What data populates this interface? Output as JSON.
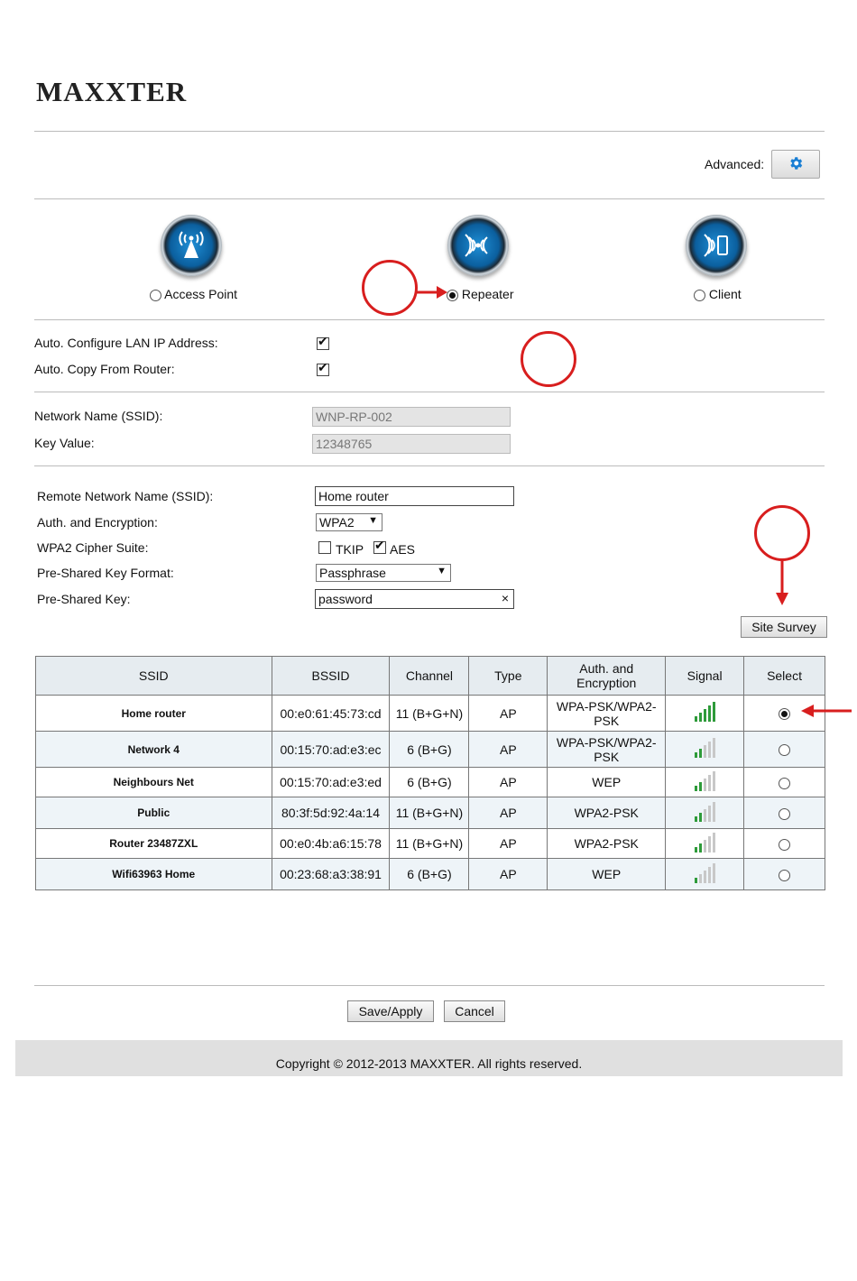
{
  "brand": {
    "logo": "MAXXTER"
  },
  "advanced": {
    "label": "Advanced:",
    "icon": "gear-icon"
  },
  "modes": [
    {
      "label": "Access Point",
      "icon": "access-point-icon",
      "selected": false
    },
    {
      "label": "Repeater",
      "icon": "repeater-icon",
      "selected": true
    },
    {
      "label": "Client",
      "icon": "client-icon",
      "selected": false
    }
  ],
  "auto": {
    "lan_ip_label": "Auto. Configure LAN IP Address:",
    "lan_ip_checked": true,
    "copy_label": "Auto. Copy From Router:",
    "copy_checked": true
  },
  "local": {
    "ssid_label": "Network Name (SSID):",
    "ssid_value": "WNP-RP-002",
    "key_label": "Key Value:",
    "key_value": "12348765"
  },
  "remote": {
    "ssid_label": "Remote Network Name (SSID):",
    "ssid_value": "Home router",
    "auth_label": "Auth. and Encryption:",
    "auth_value": "WPA2",
    "cipher_label": "WPA2 Cipher Suite:",
    "tkip_label": "TKIP",
    "tkip_checked": false,
    "aes_label": "AES",
    "aes_checked": true,
    "psk_format_label": "Pre-Shared Key Format:",
    "psk_format_value": "Passphrase",
    "psk_label": "Pre-Shared Key:",
    "psk_value": "password",
    "clear_glyph": "×"
  },
  "site_survey": {
    "label": "Site Survey"
  },
  "table": {
    "headers": [
      "SSID",
      "BSSID",
      "Channel",
      "Type",
      "Auth. and Encryption",
      "Signal",
      "Select"
    ],
    "rows": [
      {
        "ssid": "Home router",
        "bssid": "00:e0:61:45:73:cd",
        "channel": "11 (B+G+N)",
        "type": "AP",
        "auth": "WPA-PSK/WPA2-PSK",
        "signal": 5,
        "selected": true
      },
      {
        "ssid": "Network 4",
        "bssid": "00:15:70:ad:e3:ec",
        "channel": "6 (B+G)",
        "type": "AP",
        "auth": "WPA-PSK/WPA2-PSK",
        "signal": 2,
        "selected": false
      },
      {
        "ssid": "Neighbours Net",
        "bssid": "00:15:70:ad:e3:ed",
        "channel": "6 (B+G)",
        "type": "AP",
        "auth": "WEP",
        "signal": 2,
        "selected": false
      },
      {
        "ssid": "Public",
        "bssid": "80:3f:5d:92:4a:14",
        "channel": "11 (B+G+N)",
        "type": "AP",
        "auth": "WPA2-PSK",
        "signal": 2,
        "selected": false
      },
      {
        "ssid": "Router 23487ZXL",
        "bssid": "00:e0:4b:a6:15:78",
        "channel": "11 (B+G+N)",
        "type": "AP",
        "auth": "WPA2-PSK",
        "signal": 2,
        "selected": false
      },
      {
        "ssid": "Wifi63963 Home",
        "bssid": "00:23:68:a3:38:91",
        "channel": "6 (B+G)",
        "type": "AP",
        "auth": "WEP",
        "signal": 1,
        "selected": false
      }
    ]
  },
  "actions": {
    "save_label": "Save/Apply",
    "cancel_label": "Cancel"
  },
  "footer": {
    "copyright": "Copyright © 2012-2013 MAXXTER. All rights reserved."
  },
  "colors": {
    "annotation_red": "#d81e1e",
    "signal_on": "#2e9b3a",
    "signal_off": "#c8c8c8",
    "header_bg": "#e6ecf0"
  }
}
